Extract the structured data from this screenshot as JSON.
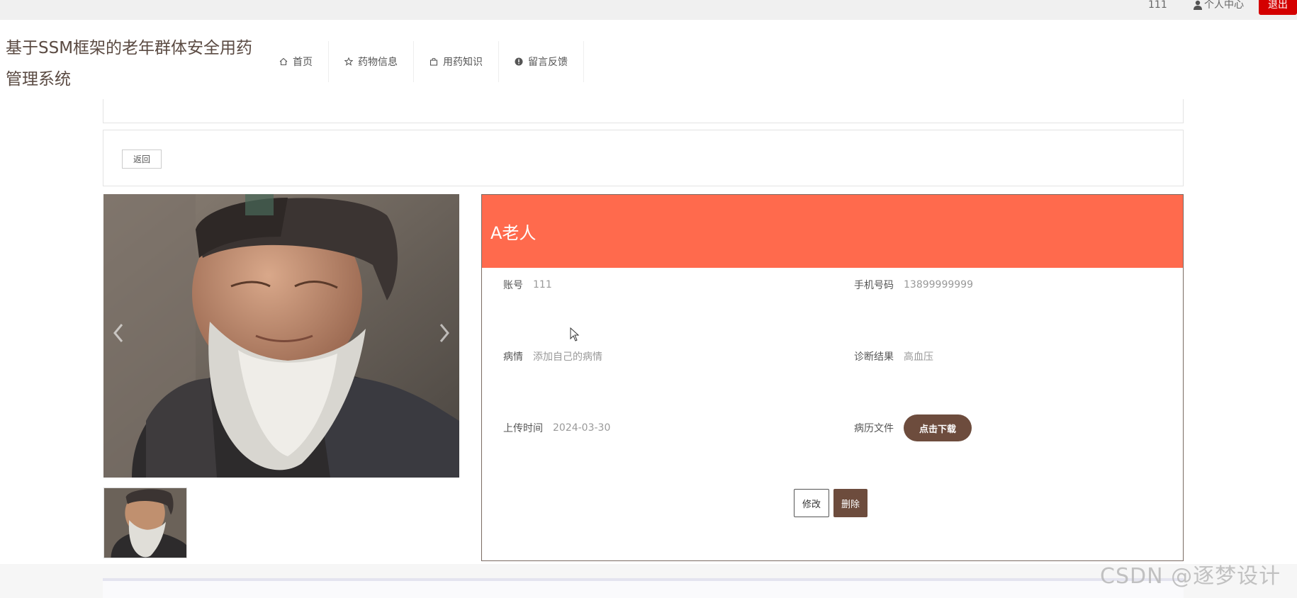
{
  "topbar": {
    "username": "111",
    "personal_center": "个人中心",
    "logout": "退出",
    "colors": {
      "logout_bg": "#d40000"
    }
  },
  "header": {
    "site_title": "基于SSM框架的老年群体安全用药管理系统",
    "nav": [
      {
        "label": "首页",
        "icon": "home-icon"
      },
      {
        "label": "药物信息",
        "icon": "star-icon"
      },
      {
        "label": "用药知识",
        "icon": "bag-icon"
      },
      {
        "label": "留言反馈",
        "icon": "exclamation-circle-icon"
      }
    ]
  },
  "back_label": "返回",
  "detail": {
    "title": "A老人",
    "fields": {
      "account_label": "账号",
      "account_value": "111",
      "phone_label": "手机号码",
      "phone_value": "13899999999",
      "condition_label": "病情",
      "condition_value": "添加自己的病情",
      "diagnosis_label": "诊断结果",
      "diagnosis_value": "高血压",
      "upload_time_label": "上传时间",
      "upload_time_value": "2024-03-30",
      "record_file_label": "病历文件",
      "download_label": "点击下载"
    },
    "actions": {
      "edit": "修改",
      "delete": "删除"
    },
    "colors": {
      "header_bg": "#ff6a4d",
      "brown": "#6d4c3d"
    }
  },
  "watermark": "CSDN @逐梦设计"
}
